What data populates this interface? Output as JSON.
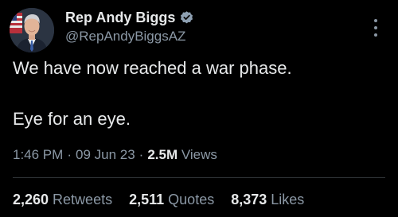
{
  "author": {
    "display_name": "Rep Andy Biggs",
    "handle": "@RepAndyBiggsAZ",
    "verified": true,
    "verified_badge_color": "#8ea0b2"
  },
  "tweet": {
    "lines": [
      "We have now reached a war phase.",
      "Eye for an eye."
    ]
  },
  "meta": {
    "time": "1:46 PM",
    "separator": "·",
    "date": "09 Jun 23",
    "views_count": "2.5M",
    "views_label": "Views"
  },
  "stats": {
    "retweets_count": "2,260",
    "retweets_label": "Retweets",
    "quotes_count": "2,511",
    "quotes_label": "Quotes",
    "likes_count": "8,373",
    "likes_label": "Likes"
  },
  "icons": {
    "avatar": "avatar-photo",
    "verified": "verified-badge-icon",
    "more": "more-vertical-icon"
  },
  "colors": {
    "background": "#000000",
    "primary_text": "#e7e9ea",
    "secondary_text": "#8b98a5"
  }
}
